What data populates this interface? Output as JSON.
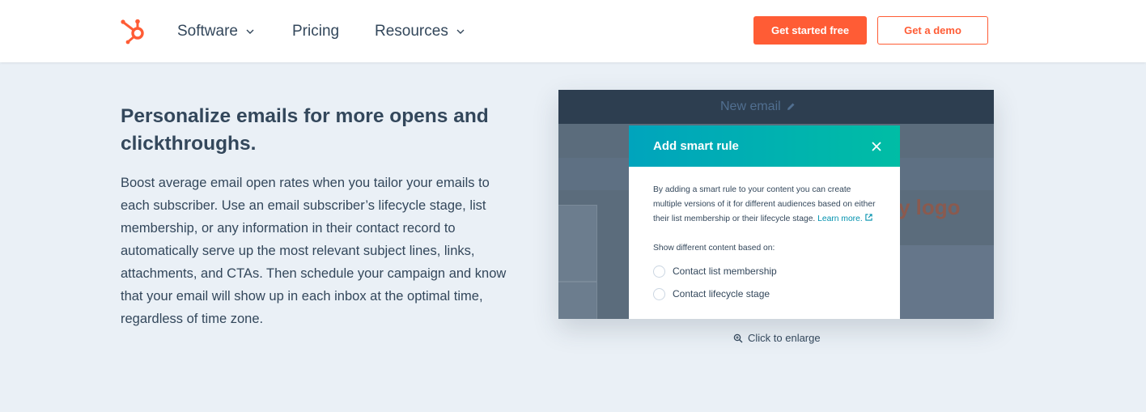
{
  "header": {
    "nav": {
      "software": "Software",
      "pricing": "Pricing",
      "resources": "Resources"
    },
    "cta_primary": "Get started free",
    "cta_secondary": "Get a demo"
  },
  "content": {
    "heading": "Personalize emails for more opens and clickthroughs.",
    "body": "Boost average email open rates when you tailor your emails to each subscriber. Use an email subscriber’s lifecycle stage, list membership, or any information in their contact record to automatically serve up the most relevant subject lines, links, attachments, and CTAs. Then schedule your campaign and know that your email will show up in each inbox at the optimal time, regardless of time zone."
  },
  "mockup": {
    "window_title": "New email",
    "bg_logo_text": "y logo",
    "modal": {
      "title": "Add smart rule",
      "description": "By adding a smart rule to your content you can create multiple versions of it for different audiences based on either their list membership or their lifecycle stage.",
      "learn_more": "Learn more.",
      "subheading": "Show different content based on:",
      "options": [
        "Contact list membership",
        "Contact lifecycle stage"
      ]
    },
    "enlarge_label": "Click to enlarge"
  },
  "colors": {
    "brand_orange": "#ff5c35",
    "text_dark": "#33475b",
    "page_bg": "#eaf0f6",
    "modal_teal": "#00a4bd"
  },
  "icons": {
    "logo": "hubspot-sprocket-icon",
    "chevron": "chevron-down-icon",
    "edit": "pencil-icon",
    "close": "close-icon",
    "zoom": "magnifier-icon",
    "external": "external-link-icon"
  }
}
